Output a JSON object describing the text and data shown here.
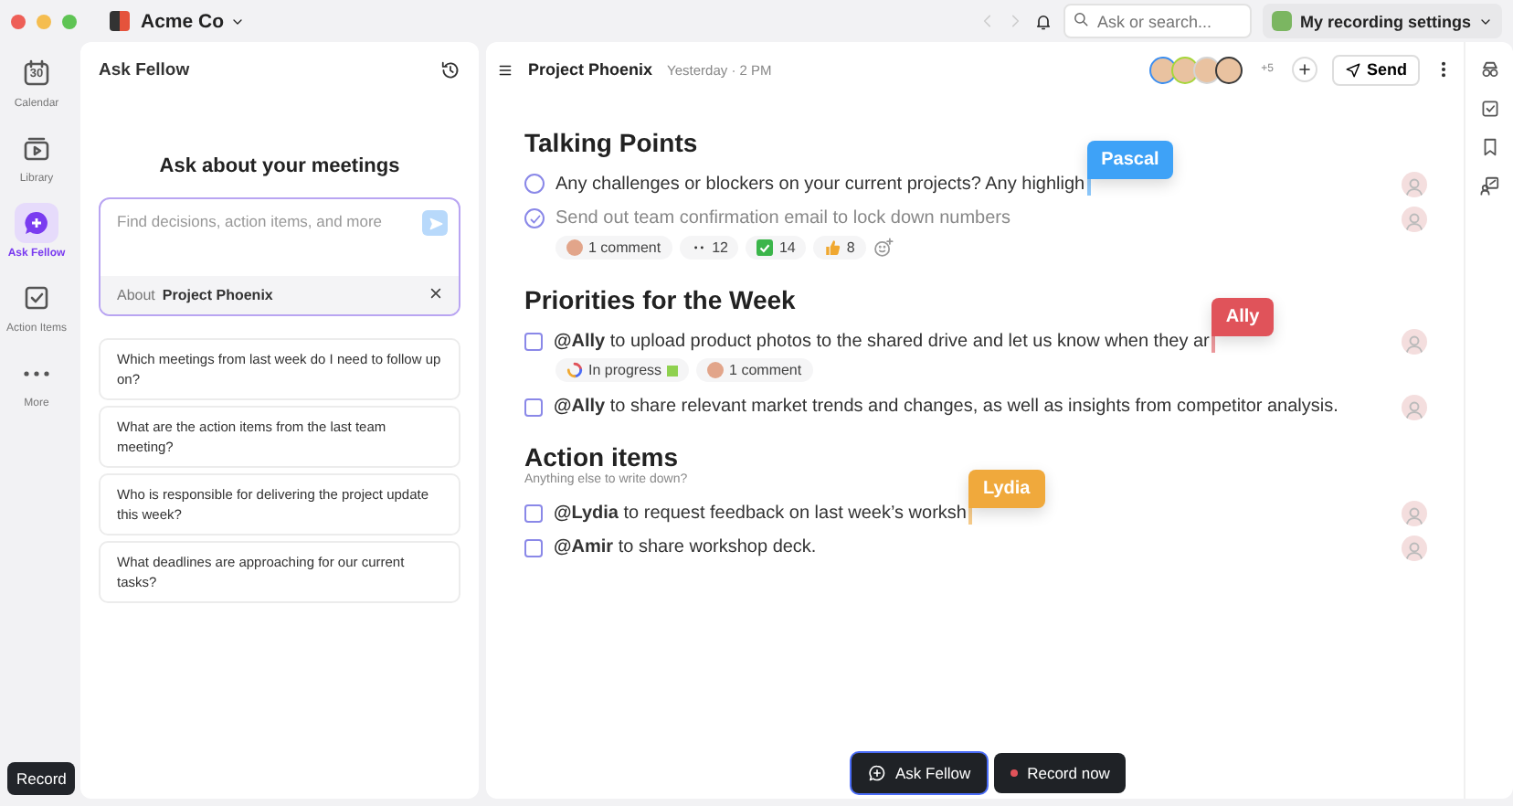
{
  "workspace": {
    "name": "Acme Co"
  },
  "topbar": {
    "search": {
      "placeholder": "Ask or search..."
    },
    "recording_settings": "My recording settings"
  },
  "nav": [
    {
      "icon_text": "30",
      "label": "Calendar",
      "selected": false
    },
    {
      "label": "Library",
      "selected": false
    },
    {
      "label": "Ask Fellow",
      "selected": true
    },
    {
      "label": "Action Items",
      "selected": false
    },
    {
      "label": "More",
      "selected": false
    }
  ],
  "record_button": "Record",
  "ask_panel": {
    "title": "Ask Fellow",
    "heading": "Ask about your meetings",
    "input": {
      "placeholder": "Find decisions, action items, and more"
    },
    "context": {
      "label": "About",
      "value": "Project Phoenix"
    },
    "suggestions": [
      "Which meetings from last week do I need to follow up on?",
      "What are the action items from the last team meeting?",
      "Who is responsible for delivering the project update this week?",
      "What deadlines are approaching for our current tasks?"
    ]
  },
  "note": {
    "title": "Project Phoenix",
    "time": "Yesterday · 2 PM",
    "attendees": [
      {
        "color": "#3b8ef0"
      },
      {
        "color": "#a6d63a"
      },
      {
        "color": "#d4d4d4"
      },
      {
        "color": "#3a3a3a"
      }
    ],
    "attendees_more": "+5",
    "send": "Send",
    "sections": [
      {
        "title": "Talking Points",
        "items": [
          {
            "kind": "topic",
            "checked": false,
            "text": "Any challenges or blockers on your current projects? Any highligh",
            "cursor": {
              "name": "Pascal",
              "color": "#3ea2f7"
            }
          },
          {
            "kind": "topic",
            "checked": true,
            "text": "Send out team confirmation email to lock down numbers",
            "chips": [
              {
                "kind": "comment",
                "text": "1 comment"
              },
              {
                "kind": "eyes",
                "text": "12"
              },
              {
                "kind": "checkmark",
                "text": "14"
              },
              {
                "kind": "thumbsup",
                "text": "8"
              },
              {
                "kind": "add-reaction"
              }
            ]
          }
        ]
      },
      {
        "title": "Priorities for the Week",
        "items": [
          {
            "kind": "action",
            "checked": false,
            "text": "**@Ally** to upload product photos to the shared drive and let us know when they ar",
            "cursor": {
              "name": "Ally",
              "color": "#e0535a"
            },
            "chips": [
              {
                "kind": "status",
                "text": "In progress",
                "color": "#8fd14f"
              },
              {
                "kind": "comment",
                "text": "1 comment"
              }
            ]
          },
          {
            "kind": "action",
            "checked": false,
            "text": "**@Ally** to share relevant market trends and changes, as well as insights from competitor analysis."
          }
        ]
      },
      {
        "title": "Action items",
        "subtitle": "Anything else to write down?",
        "items": [
          {
            "kind": "action",
            "checked": false,
            "text": "**@Lydia** to request feedback on last week’s worksh",
            "cursor": {
              "name": "Lydia",
              "color": "#f0a93c"
            }
          },
          {
            "kind": "action",
            "checked": false,
            "text": "**@Amir** to share workshop deck."
          }
        ]
      }
    ]
  },
  "floating": {
    "ask": "Ask Fellow",
    "record": "Record now"
  }
}
